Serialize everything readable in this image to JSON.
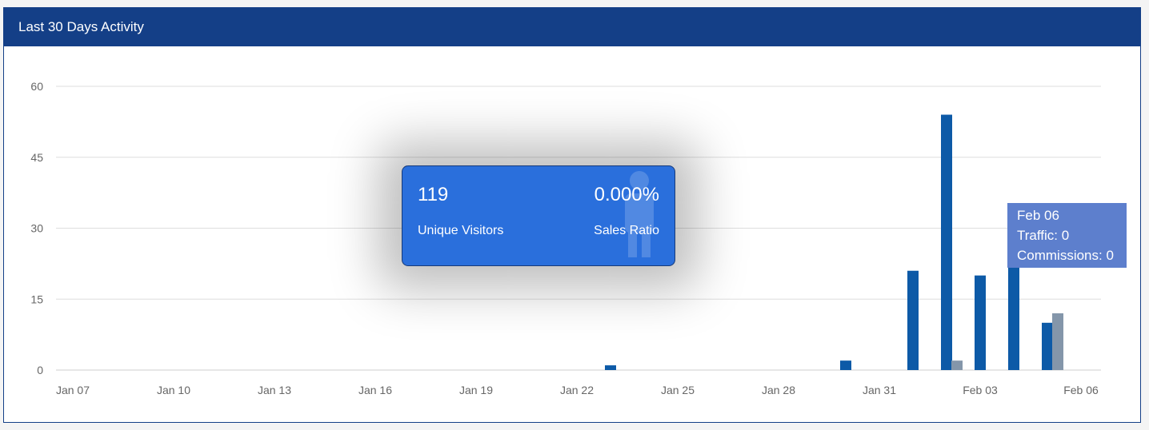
{
  "panel": {
    "title": "Last 30 Days Activity"
  },
  "stats": {
    "visitors_value": "119",
    "visitors_label": "Unique Visitors",
    "ratio_value": "0.000%",
    "ratio_label": "Sales Ratio",
    "watermark_icon": "person-icon"
  },
  "tooltip": {
    "title": "Feb 06",
    "traffic": "Traffic: 0",
    "commissions": "Commissions: 0"
  },
  "colors": {
    "header": "#143f87",
    "traffic_bar": "#0d5aa7",
    "commission_bar": "#8496aa",
    "card": "#2a6fdc",
    "tooltip": "#5d7fcd"
  },
  "chart_data": {
    "type": "bar",
    "ylim": [
      0,
      60
    ],
    "yticks": [
      0,
      15,
      30,
      45,
      60
    ],
    "x_tick_labels": [
      "Jan 07",
      "Jan 10",
      "Jan 13",
      "Jan 16",
      "Jan 19",
      "Jan 22",
      "Jan 25",
      "Jan 28",
      "Jan 31",
      "Feb 03",
      "Feb 06"
    ],
    "categories": [
      "Jan 07",
      "Jan 08",
      "Jan 09",
      "Jan 10",
      "Jan 11",
      "Jan 12",
      "Jan 13",
      "Jan 14",
      "Jan 15",
      "Jan 16",
      "Jan 17",
      "Jan 18",
      "Jan 19",
      "Jan 20",
      "Jan 21",
      "Jan 22",
      "Jan 23",
      "Jan 24",
      "Jan 25",
      "Jan 26",
      "Jan 27",
      "Jan 28",
      "Jan 29",
      "Jan 30",
      "Jan 31",
      "Feb 01",
      "Feb 02",
      "Feb 03",
      "Feb 04",
      "Feb 05",
      "Feb 06"
    ],
    "series": [
      {
        "values": [
          0,
          0,
          0,
          0,
          0,
          0,
          0,
          0,
          0,
          0,
          0,
          0,
          0,
          0,
          0,
          0,
          1,
          0,
          0,
          0,
          0,
          0,
          0,
          2,
          0,
          21,
          54,
          20,
          24,
          10,
          0
        ]
      },
      {
        "values": [
          0,
          0,
          0,
          0,
          0,
          0,
          0,
          0,
          0,
          0,
          0,
          0,
          0,
          0,
          0,
          0,
          0,
          0,
          0,
          0,
          0,
          0,
          0,
          0,
          0,
          0,
          2,
          0,
          0,
          12,
          0
        ]
      }
    ],
    "grid": true,
    "legend": "none"
  }
}
